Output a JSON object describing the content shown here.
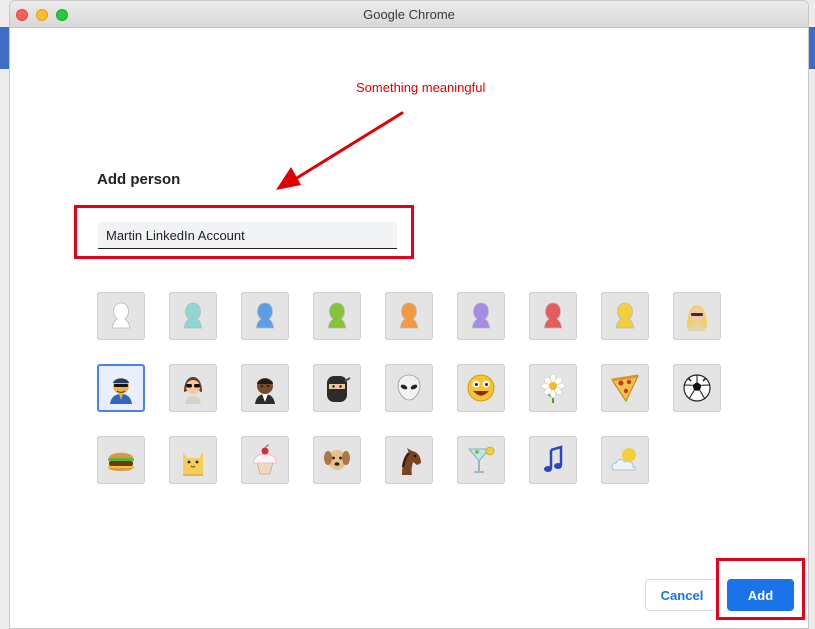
{
  "window": {
    "title": "Google Chrome"
  },
  "annotation": {
    "text": "Something meaningful",
    "color": "#e00000"
  },
  "dialog": {
    "heading": "Add person",
    "name_value": "Martin LinkedIn Account",
    "cancel_label": "Cancel",
    "add_label": "Add",
    "selected_avatar": "avatar-businessman-icon",
    "avatars": [
      {
        "name": "avatar-white-silhouette-icon",
        "color": "#ffffff"
      },
      {
        "name": "avatar-teal-silhouette-icon",
        "color": "#8fd6cf"
      },
      {
        "name": "avatar-blue-silhouette-icon",
        "color": "#5b9ee6"
      },
      {
        "name": "avatar-green-silhouette-icon",
        "color": "#86c23a"
      },
      {
        "name": "avatar-orange-silhouette-icon",
        "color": "#f29a3c"
      },
      {
        "name": "avatar-purple-silhouette-icon",
        "color": "#a48be6"
      },
      {
        "name": "avatar-red-silhouette-icon",
        "color": "#e65c5c"
      },
      {
        "name": "avatar-yellow-silhouette-icon",
        "color": "#f2cf3c"
      },
      {
        "name": "avatar-blonde-woman-icon"
      },
      {
        "name": "avatar-businessman-icon"
      },
      {
        "name": "avatar-woman-sunglasses-icon"
      },
      {
        "name": "avatar-man-suit-icon"
      },
      {
        "name": "avatar-ninja-icon"
      },
      {
        "name": "avatar-alien-icon"
      },
      {
        "name": "avatar-smiley-icon"
      },
      {
        "name": "avatar-flower-icon"
      },
      {
        "name": "avatar-pizza-icon"
      },
      {
        "name": "avatar-soccer-ball-icon"
      },
      {
        "name": "avatar-burger-icon"
      },
      {
        "name": "avatar-cat-icon"
      },
      {
        "name": "avatar-cupcake-icon"
      },
      {
        "name": "avatar-dog-icon"
      },
      {
        "name": "avatar-horse-icon"
      },
      {
        "name": "avatar-cocktail-icon"
      },
      {
        "name": "avatar-music-note-icon"
      },
      {
        "name": "avatar-sun-cloud-icon"
      }
    ]
  },
  "colors": {
    "accent": "#1a73e8",
    "highlight": "#e3001b"
  }
}
